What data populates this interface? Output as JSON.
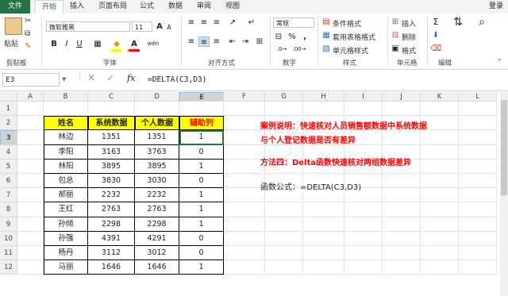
{
  "ribbon": {
    "tabs": [
      "文件",
      "开始",
      "插入",
      "页面布局",
      "公式",
      "数据",
      "审阅",
      "视图"
    ],
    "active_tab": "开始",
    "login": "登录",
    "clipboard": {
      "paste": "粘贴",
      "group": "剪贴板"
    },
    "font": {
      "name": "微软雅黑",
      "size": "11",
      "bold": "B",
      "italic": "I",
      "underline": "U",
      "grow": "A",
      "shrink": "A",
      "wen": "wén",
      "group": "字体"
    },
    "alignment": {
      "group": "对齐方式"
    },
    "number": {
      "format": "常规",
      "percent": "%",
      "comma": ",",
      "group": "数字"
    },
    "styles": {
      "conditional": "条件格式",
      "table": "套用表格格式",
      "cell": "单元格样式",
      "group": "样式"
    },
    "cells": {
      "insert": "插入",
      "delete": "删除",
      "format": "格式",
      "group": "单元格"
    },
    "editing": {
      "sigma": "Σ",
      "group": "编辑"
    }
  },
  "formula_bar": {
    "name_box": "E3",
    "fx": "fx",
    "formula": "=DELTA(C3,D3)"
  },
  "columns": [
    "A",
    "B",
    "C",
    "D",
    "E",
    "F",
    "G",
    "H",
    "I",
    "J",
    "K",
    "L"
  ],
  "rows": [
    "1",
    "2",
    "3",
    "4",
    "5",
    "6",
    "7",
    "8",
    "9",
    "10",
    "11",
    "12"
  ],
  "table": {
    "headers": [
      "姓名",
      "系统数据",
      "个人数据",
      "辅助列"
    ],
    "rows": [
      [
        "林边",
        "1351",
        "1351",
        "1"
      ],
      [
        "李阳",
        "3163",
        "3763",
        "0"
      ],
      [
        "林阳",
        "3895",
        "3895",
        "1"
      ],
      [
        "包总",
        "3830",
        "3030",
        "0"
      ],
      [
        "郝丽",
        "2232",
        "2232",
        "1"
      ],
      [
        "王红",
        "2763",
        "2763",
        "1"
      ],
      [
        "孙倾",
        "2298",
        "2298",
        "1"
      ],
      [
        "孙强",
        "4391",
        "4291",
        "0"
      ],
      [
        "杨丹",
        "3112",
        "3012",
        "0"
      ],
      [
        "马丽",
        "1646",
        "1646",
        "1"
      ]
    ]
  },
  "notes": {
    "line1": "案例说明：快速核对人员销售额数据中系统数据",
    "line2": "与个人登记数据是否有差异",
    "line3": "方法四：Delta函数快速核对两组数据差异",
    "line4": "函数公式：=DELTA(C3,D3)"
  },
  "colors": {
    "excel_green": "#217346",
    "header_fill": "#ffff00",
    "note_red": "#ff0000"
  }
}
